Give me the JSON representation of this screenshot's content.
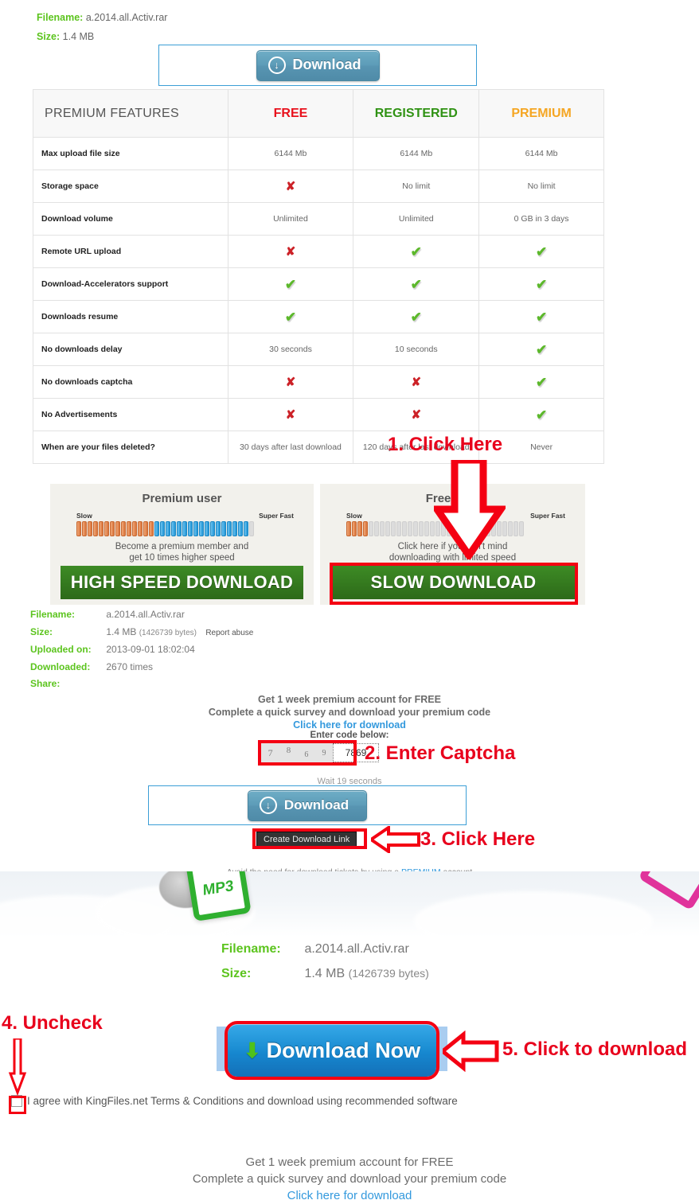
{
  "top_file": {
    "filename_label": "Filename:",
    "filename": "a.2014.all.Activ.rar",
    "size_label": "Size:",
    "size": "1.4 MB"
  },
  "download_button": {
    "label": "Download",
    "icon": "download-circle-arrow-icon"
  },
  "features_table": {
    "headers": [
      "PREMIUM FEATURES",
      "FREE",
      "REGISTERED",
      "PREMIUM"
    ],
    "header_colors": {
      "free": "#e8111c",
      "registered": "#2f9213",
      "premium": "#f5a623"
    },
    "rows": [
      {
        "feature": "Max upload file size",
        "free": "6144 Mb",
        "registered": "6144 Mb",
        "premium": "6144 Mb"
      },
      {
        "feature": "Storage space",
        "free": "✘",
        "registered": "No limit",
        "premium": "No limit"
      },
      {
        "feature": "Download volume",
        "free": "Unlimited",
        "registered": "Unlimited",
        "premium": "0 GB in 3 days"
      },
      {
        "feature": "Remote URL upload",
        "free": "✘",
        "registered": "✔",
        "premium": "✔"
      },
      {
        "feature": "Download-Accelerators support",
        "free": "✔",
        "registered": "✔",
        "premium": "✔"
      },
      {
        "feature": "Downloads resume",
        "free": "✔",
        "registered": "✔",
        "premium": "✔"
      },
      {
        "feature": "No downloads delay",
        "free": "30 seconds",
        "registered": "10 seconds",
        "premium": "✔"
      },
      {
        "feature": "No downloads captcha",
        "free": "✘",
        "registered": "✘",
        "premium": "✔"
      },
      {
        "feature": "No Advertisements",
        "free": "✘",
        "registered": "✘",
        "premium": "✔"
      },
      {
        "feature": "When are your files deleted?",
        "free": "30 days after last download",
        "registered": "120 days after last download",
        "premium": "Never"
      }
    ]
  },
  "premium_panel": {
    "title": "Premium user",
    "slow_label": "Slow",
    "fast_label": "Super Fast",
    "subtitle_line1": "Become a premium member and",
    "subtitle_line2": "get 10 times higher speed",
    "button_label": "HIGH SPEED DOWNLOAD",
    "bars_orange": 14,
    "bars_blue": 17,
    "bars_total": 32
  },
  "free_panel": {
    "title": "Free user",
    "slow_label": "Slow",
    "fast_label": "Super Fast",
    "subtitle_line1": "Click here if you don't mind",
    "subtitle_line2": "downloading with limited speed",
    "button_label": "SLOW  DOWNLOAD",
    "bars_orange": 4,
    "bars_blue": 0,
    "bars_total": 32
  },
  "file_details": {
    "filename_label": "Filename:",
    "filename": "a.2014.all.Activ.rar",
    "size_label": "Size:",
    "size": "1.4 MB",
    "size_bytes": "(1426739 bytes)",
    "report_abuse": "Report abuse",
    "uploaded_label": "Uploaded on:",
    "uploaded": "2013-09-01 18:02:04",
    "downloaded_label": "Downloaded:",
    "downloaded": "2670 times",
    "share_label": "Share:"
  },
  "promo_top": {
    "line1": "Get 1 week premium account for FREE",
    "line2": "Complete a quick survey and download your premium code",
    "link": "Click here for download"
  },
  "captcha": {
    "label": "Enter code below:",
    "digits": [
      "7",
      "8",
      "6",
      "9"
    ],
    "value": "7869",
    "wait_text": "Wait 19 seconds"
  },
  "create_link": {
    "label": "Create Download Link"
  },
  "avoid_note": {
    "prefix": "Avoid the need for download tickets by using a ",
    "link": "PREMIUM",
    "suffix": " account"
  },
  "hero": {
    "icon": "mp3-file-icon",
    "icon_text": "MP3"
  },
  "bottom_file": {
    "filename_label": "Filename",
    "filename_colon": ":",
    "filename": "a.2014.all.Activ.rar",
    "size_label": "Size:",
    "size": "1.4 MB",
    "size_bytes": "(1426739 bytes)"
  },
  "download_now": {
    "label": "Download Now",
    "icon": "green-down-arrow-icon"
  },
  "agree": {
    "checked": false,
    "text": "I agree with KingFiles.net Terms & Conditions and download using recommended software"
  },
  "promo_bottom": {
    "line1": "Get 1 week premium account for FREE",
    "line2": "Complete a quick survey and download your premium code",
    "link": "Click here for download"
  },
  "annotations": {
    "step1": "1. Click Here",
    "step2": "2. Enter Captcha",
    "step3": "3. Click Here",
    "step4": "4. Uncheck",
    "step5": "5. Click to download",
    "color": "#e8001c"
  }
}
